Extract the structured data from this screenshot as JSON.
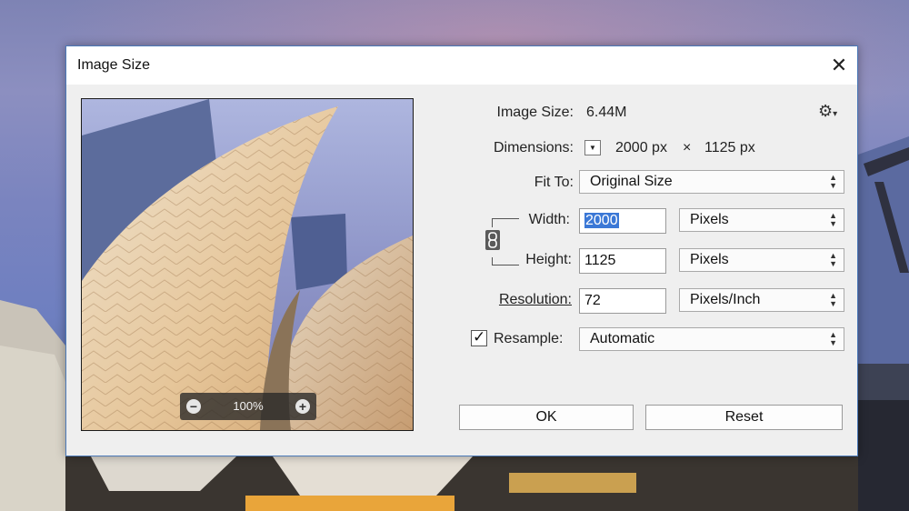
{
  "dialog": {
    "title": "Image Size",
    "close_glyph": "✕"
  },
  "preview": {
    "zoom": "100%",
    "zoom_out_glyph": "−",
    "zoom_in_glyph": "+"
  },
  "image_size": {
    "label": "Image Size:",
    "value": "6.44M"
  },
  "dimensions": {
    "label": "Dimensions:",
    "width": "2000 px",
    "times": "×",
    "height": "1125 px",
    "dropdown_glyph": "▼"
  },
  "fit_to": {
    "label": "Fit To:",
    "value": "Original Size"
  },
  "width": {
    "label": "Width:",
    "value": "2000",
    "unit": "Pixels"
  },
  "height": {
    "label": "Height:",
    "value": "1125",
    "unit": "Pixels"
  },
  "resolution": {
    "label": "Resolution:",
    "value": "72",
    "unit": "Pixels/Inch"
  },
  "resample": {
    "label": "Resample:",
    "checked": true,
    "check_glyph": "✓",
    "value": "Automatic"
  },
  "buttons": {
    "ok": "OK",
    "reset": "Reset"
  },
  "icons": {
    "gear": "⚙",
    "gear_caret": "▾",
    "select_up": "▲",
    "select_down": "▼"
  },
  "colors": {
    "accent": "#3b78d6",
    "dialog_border": "#4b79b8"
  }
}
